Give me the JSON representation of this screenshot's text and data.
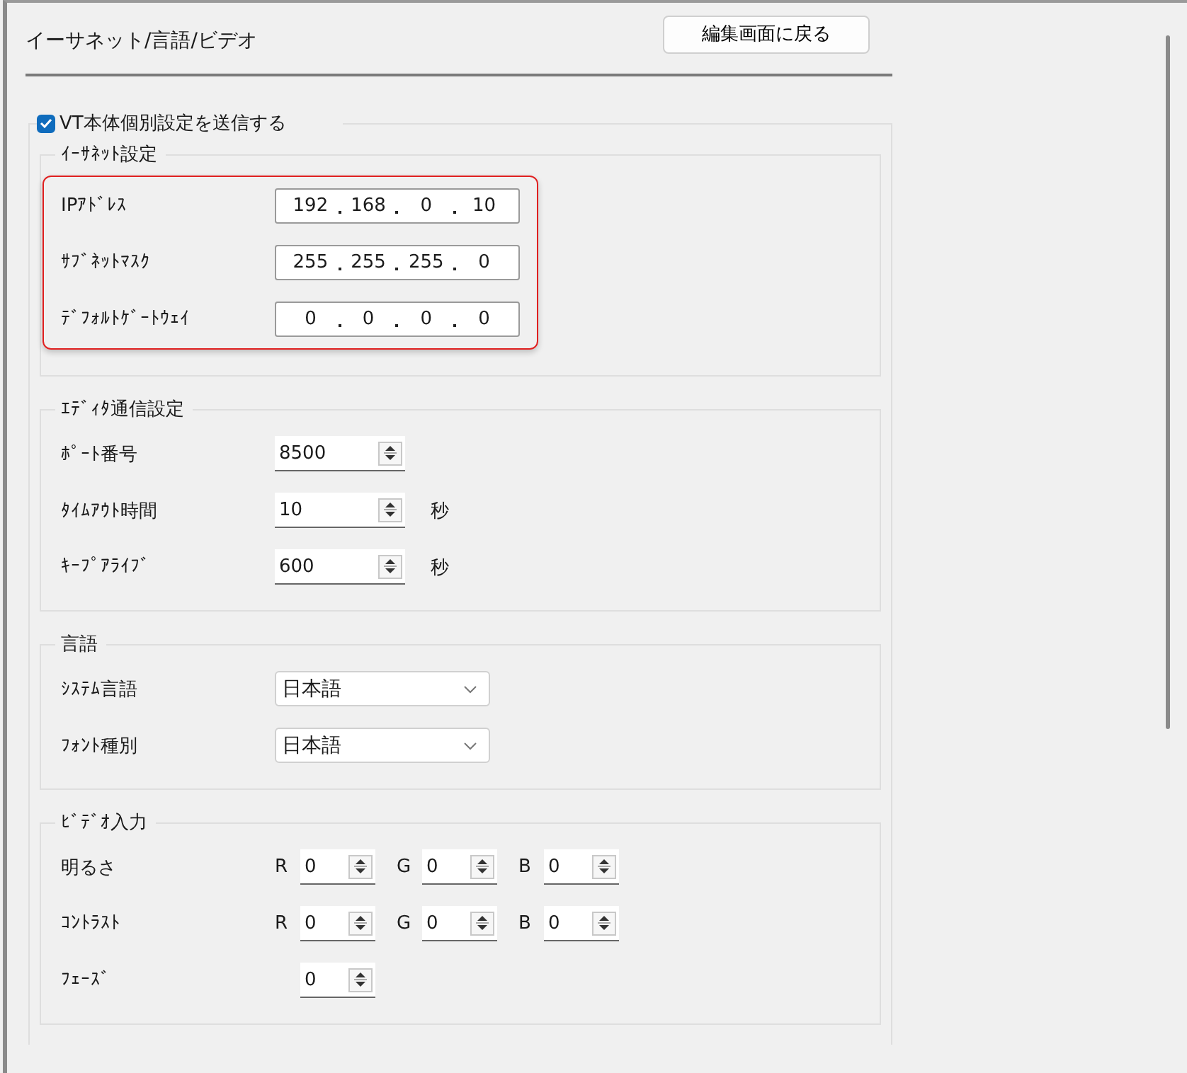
{
  "title": "イーサネット/言語/ビデオ",
  "back_button": "編集画面に戻る",
  "send_individual": {
    "label": "VT本体個別設定を送信する",
    "checked": true
  },
  "groups": [
    {
      "title": "ｲｰｻﾈｯﾄ設定",
      "highlighted": true,
      "rows": [
        {
          "kind": "ip",
          "label": "IPｱﾄﾞﾚｽ",
          "octets": [
            "192",
            "168",
            "0",
            "10"
          ]
        },
        {
          "kind": "ip",
          "label": "ｻﾌﾞﾈｯﾄﾏｽｸ",
          "octets": [
            "255",
            "255",
            "255",
            "0"
          ]
        },
        {
          "kind": "ip",
          "label": "ﾃﾞﾌｫﾙﾄｹﾞｰﾄｳｪｲ",
          "octets": [
            "0",
            "0",
            "0",
            "0"
          ]
        }
      ]
    },
    {
      "title": "ｴﾃﾞｨﾀ通信設定",
      "highlighted": false,
      "rows": [
        {
          "kind": "spin",
          "label": "ﾎﾟｰﾄ番号",
          "value": "8500"
        },
        {
          "kind": "spin",
          "label": "ﾀｲﾑｱｳﾄ時間",
          "value": "10",
          "unit": "秒"
        },
        {
          "kind": "spin",
          "label": "ｷｰﾌﾟｱﾗｲﾌﾞ",
          "value": "600",
          "unit": "秒"
        }
      ]
    },
    {
      "title": "言語",
      "highlighted": false,
      "rows": [
        {
          "kind": "select",
          "label": "ｼｽﾃﾑ言語",
          "value": "日本語"
        },
        {
          "kind": "select",
          "label": "ﾌｫﾝﾄ種別",
          "value": "日本語"
        }
      ]
    },
    {
      "title": "ﾋﾞﾃﾞｵ入力",
      "highlighted": false,
      "rows": [
        {
          "kind": "rgb",
          "label": "明るさ",
          "channels": [
            {
              "name": "R",
              "value": "0"
            },
            {
              "name": "G",
              "value": "0"
            },
            {
              "name": "B",
              "value": "0"
            }
          ]
        },
        {
          "kind": "rgb",
          "label": "ｺﾝﾄﾗｽﾄ",
          "channels": [
            {
              "name": "R",
              "value": "0"
            },
            {
              "name": "G",
              "value": "0"
            },
            {
              "name": "B",
              "value": "0"
            }
          ]
        },
        {
          "kind": "single",
          "label": "ﾌｪｰｽﾞ",
          "value": "0"
        }
      ]
    }
  ]
}
